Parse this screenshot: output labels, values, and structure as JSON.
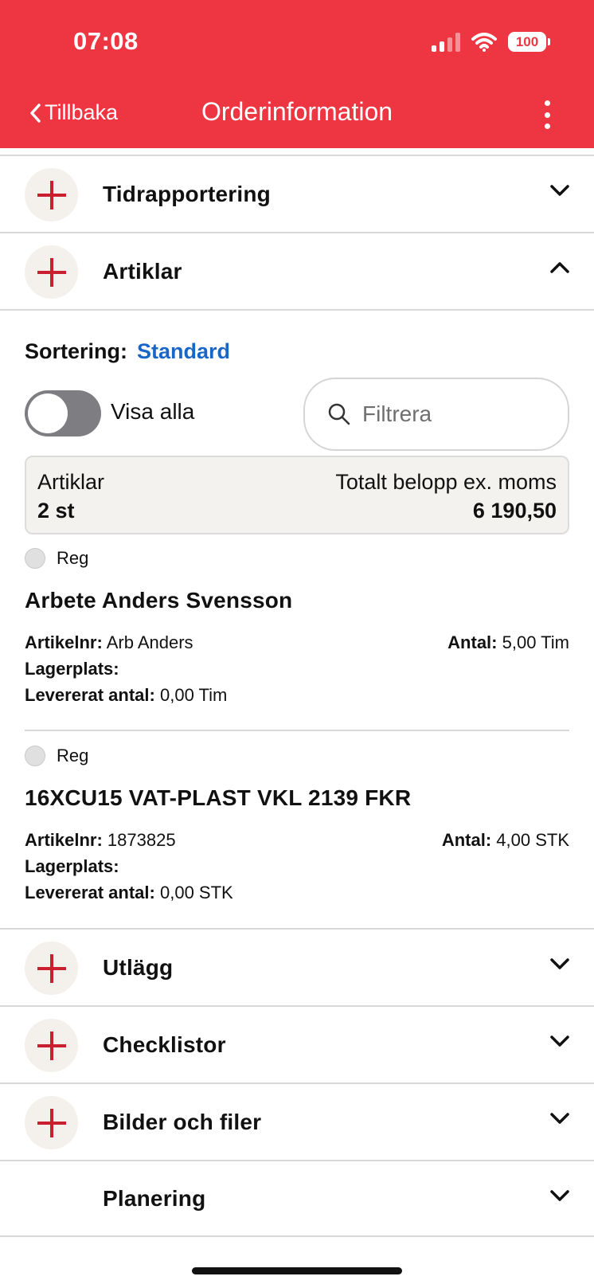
{
  "status": {
    "time": "07:08",
    "battery": "100"
  },
  "nav": {
    "back_label": "Tillbaka",
    "title": "Orderinformation"
  },
  "sections": {
    "tidrapportering": "Tidrapportering",
    "artiklar": "Artiklar",
    "utlagg": "Utlägg",
    "checklistor": "Checklistor",
    "bilder": "Bilder och filer",
    "planering": "Planering"
  },
  "articles_panel": {
    "sort_label": "Sortering:",
    "sort_value": "Standard",
    "toggle_label": "Visa alla",
    "filter_placeholder": "Filtrera",
    "summary": {
      "left_label": "Artiklar",
      "left_value": "2 st",
      "right_label": "Totalt belopp ex. moms",
      "right_value": "6 190,50"
    },
    "items": [
      {
        "status": "Reg",
        "title": "Arbete Anders Svensson",
        "artikelnr_label": "Artikelnr:",
        "artikelnr": "Arb Anders",
        "lagerplats_label": "Lagerplats:",
        "levererat_label": "Levererat antal:",
        "levererat": "0,00 Tim",
        "antal_label": "Antal:",
        "antal": "5,00 Tim"
      },
      {
        "status": "Reg",
        "title": "16XCU15 VAT-PLAST VKL 2139 FKR",
        "artikelnr_label": "Artikelnr:",
        "artikelnr": "1873825",
        "lagerplats_label": "Lagerplats:",
        "levererat_label": "Levererat antal:",
        "levererat": "0,00 STK",
        "antal_label": "Antal:",
        "antal": "4,00 STK"
      }
    ]
  },
  "colors": {
    "brand": "#ee3643",
    "link": "#1a66c7",
    "plus": "#c8202e"
  },
  "icons": {
    "back": "chevron-left-icon",
    "more": "more-vertical-icon",
    "add": "plus-icon",
    "expand": "chevron-down-icon",
    "collapse": "chevron-up-icon",
    "search": "search-icon"
  }
}
